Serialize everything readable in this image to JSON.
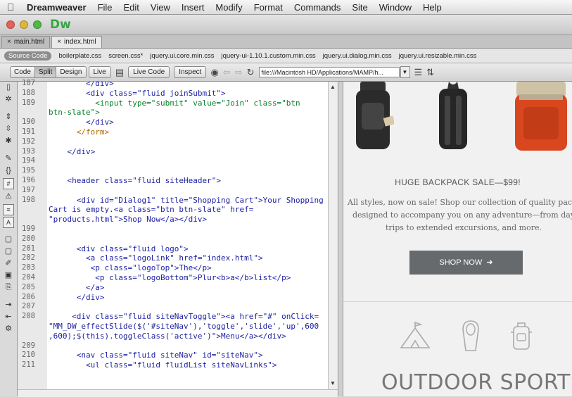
{
  "menubar": {
    "app": "Dreamweaver",
    "items": [
      "File",
      "Edit",
      "View",
      "Insert",
      "Modify",
      "Format",
      "Commands",
      "Site",
      "Window",
      "Help"
    ]
  },
  "window": {
    "logo": "Dw"
  },
  "doc_tabs": [
    "main.html",
    "index.html"
  ],
  "related_files": [
    "Source Code",
    "boilerplate.css",
    "screen.css*",
    "jquery.ui.core.min.css",
    "jquery-ui-1.10.1.custom.min.css",
    "jquery.ui.dialog.min.css",
    "jquery.ui.resizable.min.css"
  ],
  "toolbar": {
    "view_buttons": [
      "Code",
      "Split",
      "Design"
    ],
    "live": "Live",
    "live_code": "Live Code",
    "inspect": "Inspect",
    "address": "file:///Macintosh HD/Applications/MAMP/h..."
  },
  "code": {
    "numbers": [
      "187",
      "188",
      "189",
      "190",
      "191",
      "192",
      "193",
      "194",
      "195",
      "196",
      "197",
      "198",
      "199",
      "200",
      "201",
      "202",
      "203",
      "204",
      "205",
      "206",
      "207",
      "208",
      "209",
      "210",
      "211"
    ],
    "lines": [
      "        </div>",
      "        <div class=\"fluid joinSubmit\">",
      "          <input type=\"submit\" value=\"Join\" class=\"btn",
      "btn-slate\">",
      "        </div>",
      "      </form>",
      "",
      "    </div>",
      "",
      "",
      "    <header class=\"fluid siteHeader\">",
      "",
      "      <div id=\"Dialog1\" title=\"Shopping Cart\">Your Shopping",
      "Cart is empty.<a class=\"btn btn-slate\" href=",
      "\"products.html\">Shop Now</a></div>",
      "",
      "",
      "      <div class=\"fluid logo\">",
      "        <a class=\"logoLink\" href=\"index.html\">",
      "         <p class=\"logoTop\">The</p>",
      "          <p class=\"logoBottom\">Plur<b>a</b>list</p>",
      "        </a>",
      "      </div>",
      "",
      "     <div class=\"fluid siteNavToggle\"><a href=\"#\" onClick=",
      "\"MM_DW_effectSlide($('#siteNav'),'toggle','slide','up',600",
      ",600);$(this).toggleClass('active')\">Menu</a></div>",
      "",
      "      <nav class=\"fluid siteNav\" id=\"siteNav\">",
      "        <ul class=\"fluid fluidList siteNavLinks\">"
    ]
  },
  "preview": {
    "sale_title": "HUGE BACKPACK SALE—$99!",
    "sale_line1": "All styles, now on sale! Shop our collection of quality packs",
    "sale_line2": "designed to accompany you on any adventure—from day",
    "sale_line3": "trips to extended excursions, and more.",
    "button": "SHOP NOW",
    "heading": "OUTDOOR SPORTS"
  }
}
